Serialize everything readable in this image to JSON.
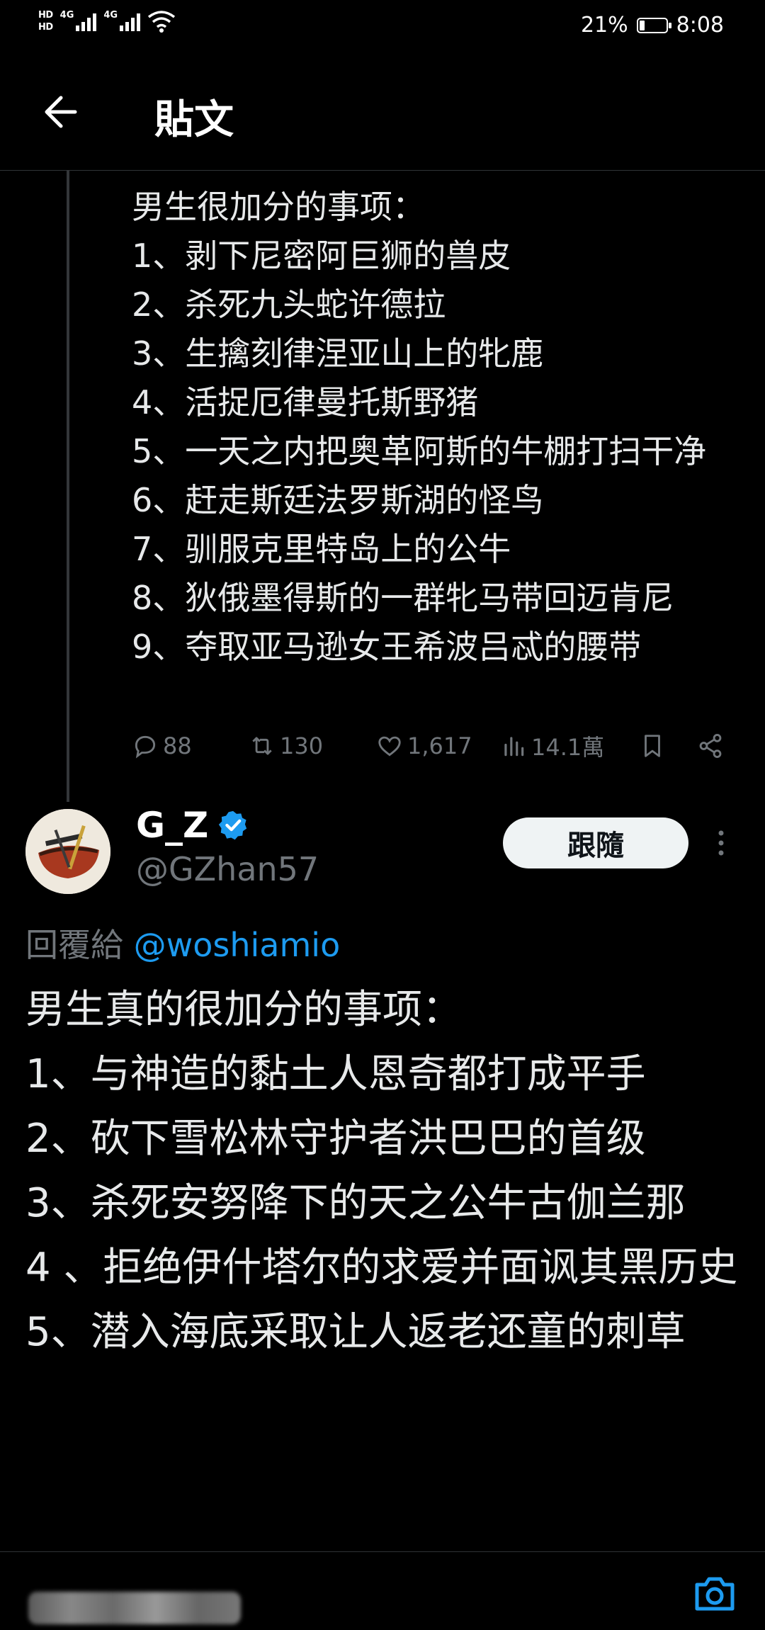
{
  "status_bar": {
    "hd1": "HD",
    "hd2": "HD",
    "net1": "4G",
    "net2": "4G",
    "battery_percent": "21%",
    "battery_level": 0.21,
    "time": "8:08"
  },
  "header": {
    "title": "貼文",
    "back_icon": "arrow-left-icon"
  },
  "parent_tweet": {
    "text": "男生很加分的事项：\n1、剥下尼密阿巨狮的兽皮\n2、杀死九头蛇许德拉\n3、生擒刻律涅亚山上的牝鹿\n4、活捉厄律曼托斯野猪\n5、一天之内把奥革阿斯的牛棚打扫干净\n6、赶走斯廷法罗斯湖的怪鸟\n7、驯服克里特岛上的公牛\n8、狄俄墨得斯的一群牝马带回迈肯尼\n9、夺取亚马逊女王希波吕忒的腰带",
    "actions": {
      "replies": "88",
      "retweets": "130",
      "likes": "1,617",
      "views": "14.1萬"
    }
  },
  "reply_tweet": {
    "author_name": "G_Z",
    "handle": "@GZhan57",
    "follow_label": "跟隨",
    "replying_prefix": "回覆給",
    "replying_to": "@woshiamio",
    "text": "男生真的很加分的事项：\n1、与神造的黏土人恩奇都打成平手\n2、砍下雪松林守护者洪巴巴的首级\n3、杀死安努降下的天之公牛古伽兰那\n4 、拒绝伊什塔尔的求爱并面讽其黑历史\n5、潜入海底采取让人返老还童的刺草"
  },
  "colors": {
    "background": "#000000",
    "text": "#e7e9ea",
    "secondary": "#71767b",
    "accent": "#1d9bf0"
  }
}
